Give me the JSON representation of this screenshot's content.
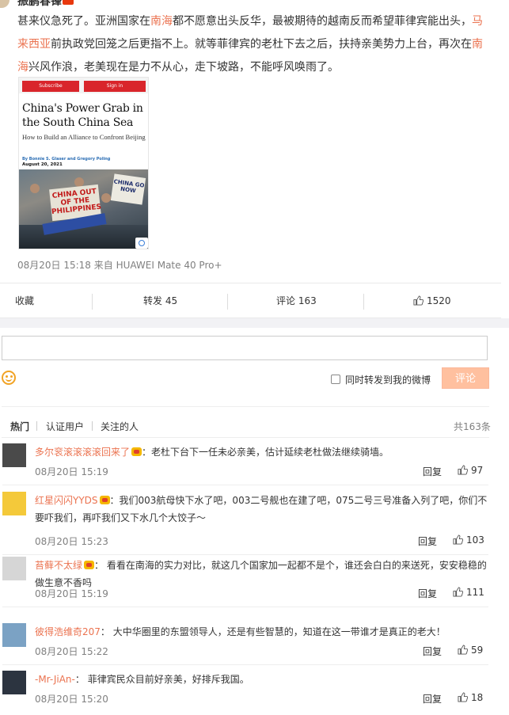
{
  "post": {
    "author_name": "振鹏春锋",
    "text_parts": [
      {
        "t": "text",
        "v": "甚来仪急死了。亚洲国家在"
      },
      {
        "t": "link",
        "v": "南海"
      },
      {
        "t": "text",
        "v": "都不愿意出头反华，最被期待的越南反而希望菲律宾能出头，"
      },
      {
        "t": "link",
        "v": "马来西亚"
      },
      {
        "t": "text",
        "v": "前执政党回笼之后更指不上。就等菲律宾的老杜下去之后，扶持亲美势力上台，再次在"
      },
      {
        "t": "link",
        "v": "南海"
      },
      {
        "t": "text",
        "v": "兴风作浪，老美现在是力不从心，走下坡路，不能呼风唤雨了。"
      }
    ],
    "meta": "08月20日 15:18  来自 HUAWEI Mate 40 Pro+",
    "article": {
      "subscribe": "Subscribe",
      "sign_in": "Sign in",
      "title": "China's Power Grab in the South China Sea",
      "subtitle": "How to Build an Alliance to Confront Beijing",
      "byline": "By Bonnie S. Glaser and Gregory Poling",
      "date": "August 20, 2021",
      "sign_text_1": "CHINA OUT OF THE PHILIPPINES",
      "sign_text_2": "CHINA GO NOW"
    }
  },
  "actions": {
    "favorite": "收藏",
    "repost": "转发 45",
    "comment": "评论 163",
    "like": "1520"
  },
  "composer": {
    "repost_label": "同时转发到我的微博",
    "submit_label": "评论"
  },
  "filters": {
    "tabs": [
      "热门",
      "认证用户",
      "关注的人"
    ],
    "total": "共163条"
  },
  "comments": [
    {
      "user": "多尔衮滚滚滚滚回来了",
      "vip": true,
      "text": "：老杜下台下一任未必亲美，估计延续老杜做法继续骑墙。",
      "time": "08月20日 15:19",
      "reply": "回复",
      "likes": "97",
      "avatar_color": "#4a4a4a"
    },
    {
      "user": "红星闪闪YYDS",
      "vip": true,
      "text": "：我们003航母快下水了吧，003二号舰也在建了吧，075二号三号准备入列了吧，你们不要吓我们，再吓我们又下水几个大饺子～",
      "time": "08月20日 15:23",
      "reply": "回复",
      "likes": "103",
      "avatar_color": "#f4c93a"
    },
    {
      "user": "苔藓不太绿",
      "vip": true,
      "text": "： 看看在南海的实力对比，就这几个国家加一起都不是个，谁还会白白的来送死，安安稳稳的做生意不香吗",
      "time": "08月20日 15:19",
      "reply": "回复",
      "likes": "111",
      "avatar_color": "#d6d6d6"
    },
    {
      "user": "彼得浩维奇207",
      "vip": false,
      "text": "： 大中华圈里的东盟领导人，还是有些智慧的，知道在这一带谁才是真正的老大！",
      "time": "08月20日 15:22",
      "reply": "回复",
      "likes": "59",
      "avatar_color": "#7ba2c4"
    },
    {
      "user": "-Mr-JiAn-",
      "vip": false,
      "text": "： 菲律宾民众目前好亲美，好排斥我国。",
      "time": "08月20日 15:20",
      "reply": "回复",
      "likes": "18",
      "avatar_color": "#2c3440"
    }
  ]
}
